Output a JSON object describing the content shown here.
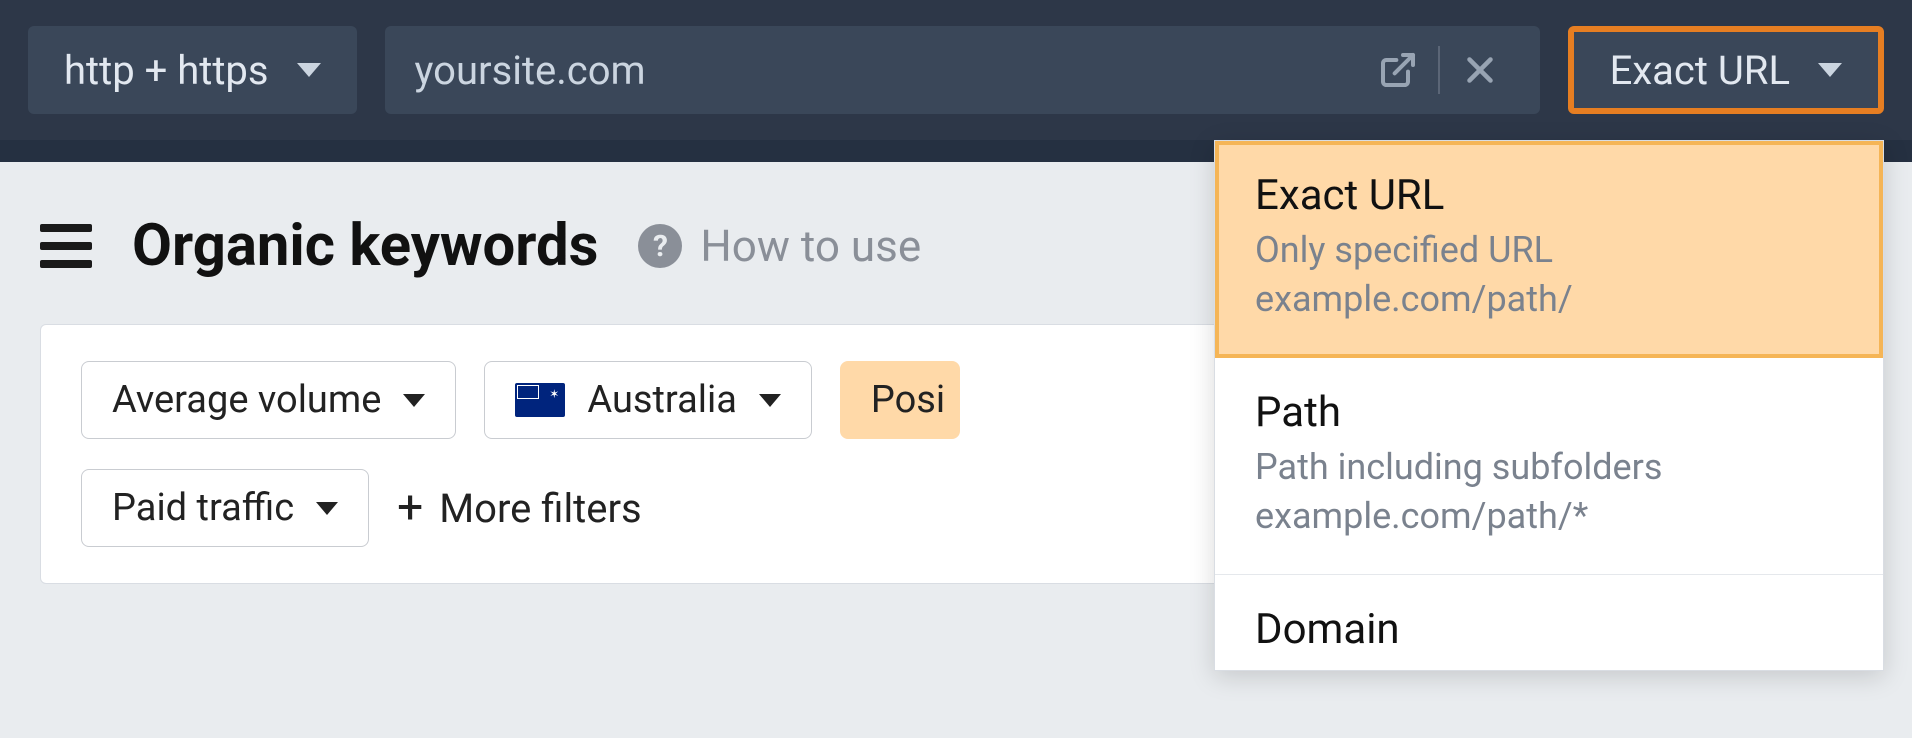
{
  "topbar": {
    "protocol_label": "http + https",
    "url_value": "yoursite.com",
    "mode_label": "Exact URL"
  },
  "page": {
    "title": "Organic keywords",
    "help_label": "How to use"
  },
  "filters": {
    "volume_label": "Average volume",
    "country_label": "Australia",
    "position_label": "Posi",
    "paid_traffic_label": "Paid traffic",
    "more_filters_label": "More filters"
  },
  "mode_dropdown": {
    "items": [
      {
        "title": "Exact URL",
        "desc_line1": "Only specified URL",
        "desc_line2": "example.com/path/",
        "selected": true
      },
      {
        "title": "Path",
        "desc_line1": "Path including subfolders",
        "desc_line2": "example.com/path/*",
        "selected": false
      },
      {
        "title": "Domain",
        "desc_line1": "",
        "desc_line2": "",
        "selected": false
      }
    ]
  }
}
